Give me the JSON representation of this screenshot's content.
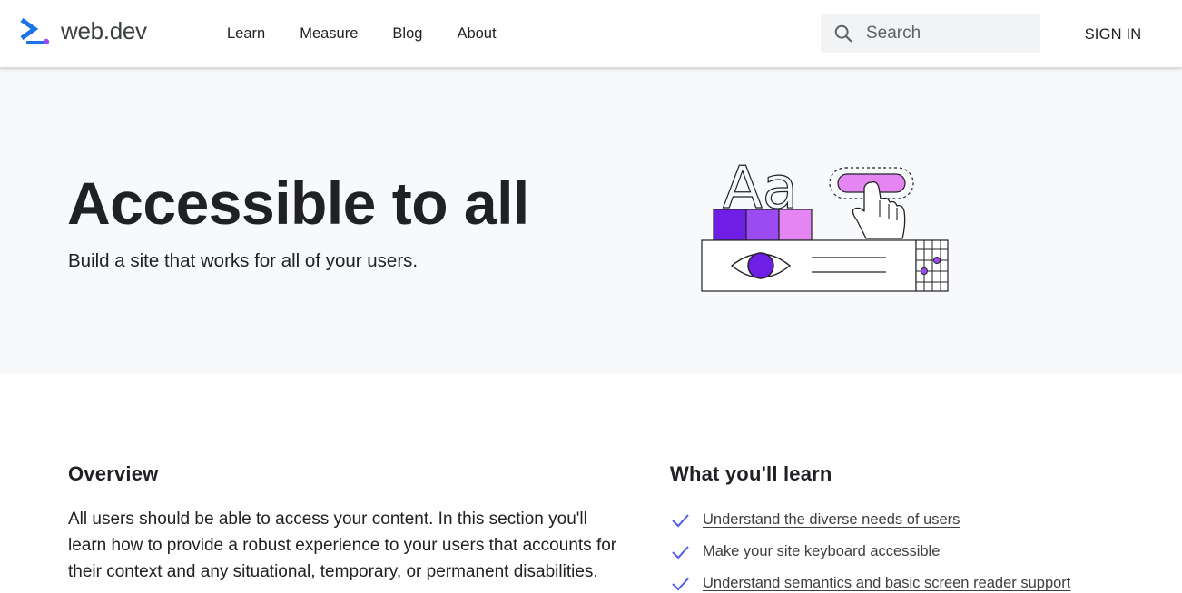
{
  "header": {
    "logo_text": "web.dev",
    "nav": [
      {
        "label": "Learn"
      },
      {
        "label": "Measure"
      },
      {
        "label": "Blog"
      },
      {
        "label": "About"
      }
    ],
    "search": {
      "placeholder": "Search",
      "value": ""
    },
    "signin_label": "SIGN IN"
  },
  "hero": {
    "title": "Accessible to all",
    "subtitle": "Build a site that works for all of your users.",
    "illustration_text": "Aa"
  },
  "overview": {
    "heading": "Overview",
    "body": "All users should be able to access your content. In this section you'll learn how to provide a robust experience to your users that accounts for their context and any situational, temporary, or permanent disabilities."
  },
  "learn": {
    "heading": "What you'll learn",
    "items": [
      {
        "label": "Understand the diverse needs of users"
      },
      {
        "label": "Make your site keyboard accessible"
      },
      {
        "label": "Understand semantics and basic screen reader support"
      }
    ]
  },
  "colors": {
    "accent_blue": "#1a73e8",
    "purple_dark": "#6f1ee6",
    "purple_mid": "#9a4cf2",
    "purple_light": "#e585f2",
    "check_blue": "#4f5ee6"
  },
  "icons": {
    "logo": "web-dev-chevron-logo",
    "search": "magnifier-icon",
    "check": "checkmark-icon"
  }
}
